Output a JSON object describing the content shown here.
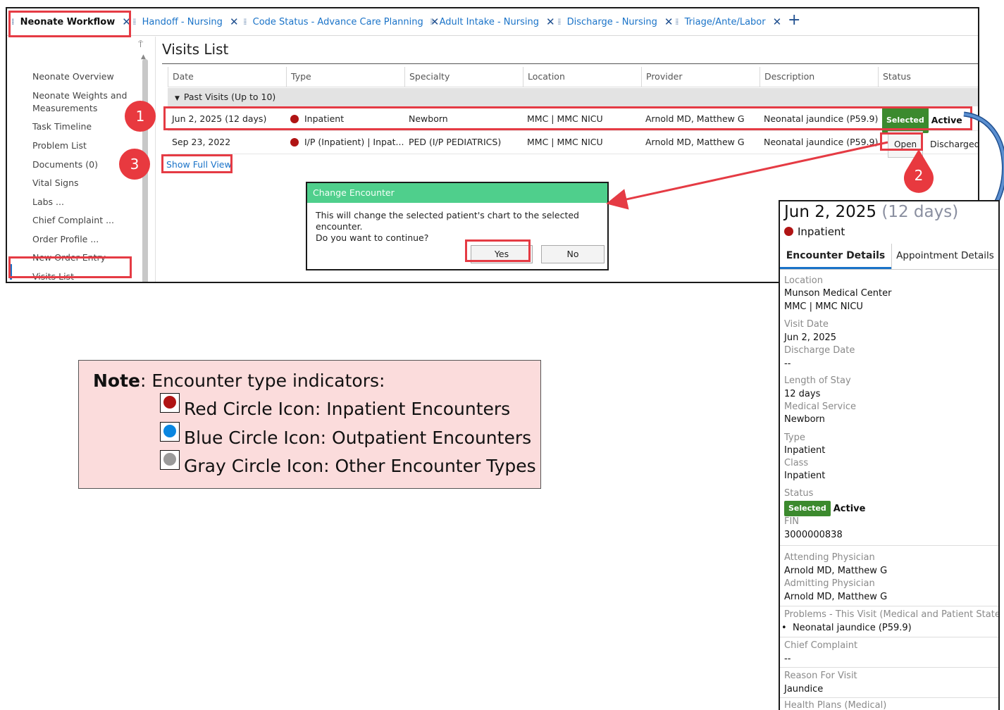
{
  "tabs": [
    {
      "label": "Neonate Workflow",
      "active": true
    },
    {
      "label": "Handoff - Nursing",
      "active": false
    },
    {
      "label": "Code Status - Advance Care Planning",
      "active": false
    },
    {
      "label": "Adult Intake - Nursing",
      "active": false
    },
    {
      "label": "Discharge - Nursing",
      "active": false
    },
    {
      "label": "Triage/Ante/Labor",
      "active": false
    }
  ],
  "nav": {
    "items": [
      "Neonate Overview",
      "Neonate Weights and",
      "Measurements",
      "Task Timeline",
      "Problem List",
      "Documents (0)",
      "Vital Signs",
      "Labs ...",
      "Chief Complaint ...",
      "Order Profile ...",
      "New Order Entry",
      "Visits List"
    ]
  },
  "visits": {
    "title": "Visits List",
    "columns": [
      "Date",
      "Type",
      "Specialty",
      "Location",
      "Provider",
      "Description",
      "Status"
    ],
    "group_label": "Past Visits (Up to 10)",
    "rows": [
      {
        "date": "Jun 2, 2025 (12 days)",
        "type": "Inpatient",
        "specialty": "Newborn",
        "location": "MMC | MMC NICU",
        "provider": "Arnold MD, Matthew G",
        "description": "Neonatal jaundice (P59.9)",
        "badge": "Selected",
        "status": "Active"
      },
      {
        "date": "Sep 23, 2022",
        "type": "I/P (Inpatient) | Inpat...",
        "specialty": "PED (I/P PEDIATRICS)",
        "location": "MMC | MMC NICU",
        "provider": "Arnold MD, Matthew G",
        "description": "Neonatal jaundice (P59.9)",
        "button": "Open",
        "status": "Discharged"
      }
    ],
    "show_full": "Show Full View"
  },
  "dialog": {
    "title": "Change Encounter",
    "line1": "This will change the selected patient's chart to the selected encounter.",
    "line2": "Do you want to continue?",
    "yes": "Yes",
    "no": "No"
  },
  "callouts": [
    "1",
    "2",
    "3"
  ],
  "panel": {
    "date": "Jun 2, 2025",
    "days": "(12 days)",
    "type": "Inpatient",
    "tab1": "Encounter Details",
    "tab2": "Appointment Details",
    "location_label": "Location",
    "location_1": "Munson Medical Center",
    "location_2": "MMC | MMC NICU",
    "visit_date_label": "Visit Date",
    "visit_date": "Jun 2, 2025",
    "discharge_label": "Discharge Date",
    "discharge": "--",
    "los_label": "Length of Stay",
    "los": "12 days",
    "service_label": "Medical Service",
    "service": "Newborn",
    "type_label": "Type",
    "type_value": "Inpatient",
    "class_label": "Class",
    "class_value": "Inpatient",
    "status_label": "Status",
    "status_badge": "Selected",
    "status_value": "Active",
    "fin_label": "FIN",
    "fin": "3000000838",
    "attending_label": "Attending Physician",
    "attending": "Arnold MD, Matthew G",
    "admitting_label": "Admitting Physician",
    "admitting": "Arnold MD, Matthew G",
    "problems_label": "Problems - This Visit (Medical and Patient Stated)",
    "problem_1": "Neonatal jaundice (P59.9)",
    "chief_label": "Chief Complaint",
    "chief": "--",
    "reason_label": "Reason For Visit",
    "reason": "Jaundice",
    "health_label": "Health Plans (Medical)"
  },
  "note": {
    "head_bold": "Note",
    "head_rest": ": Encounter type indicators:",
    "lines": [
      "Red Circle Icon: Inpatient Encounters",
      "Blue Circle Icon: Outpatient Encounters",
      "Gray Circle Icon: Other Encounter Types"
    ],
    "icon_colors": [
      "#b01414",
      "#0a86e0",
      "#9a9a9a"
    ]
  },
  "colors": {
    "accent": "#1a73c8",
    "annotation": "#e53b44",
    "selected_badge": "#3c8a2e",
    "dialog_header": "#4fcf8c",
    "note_bg": "#fbdcdc"
  }
}
